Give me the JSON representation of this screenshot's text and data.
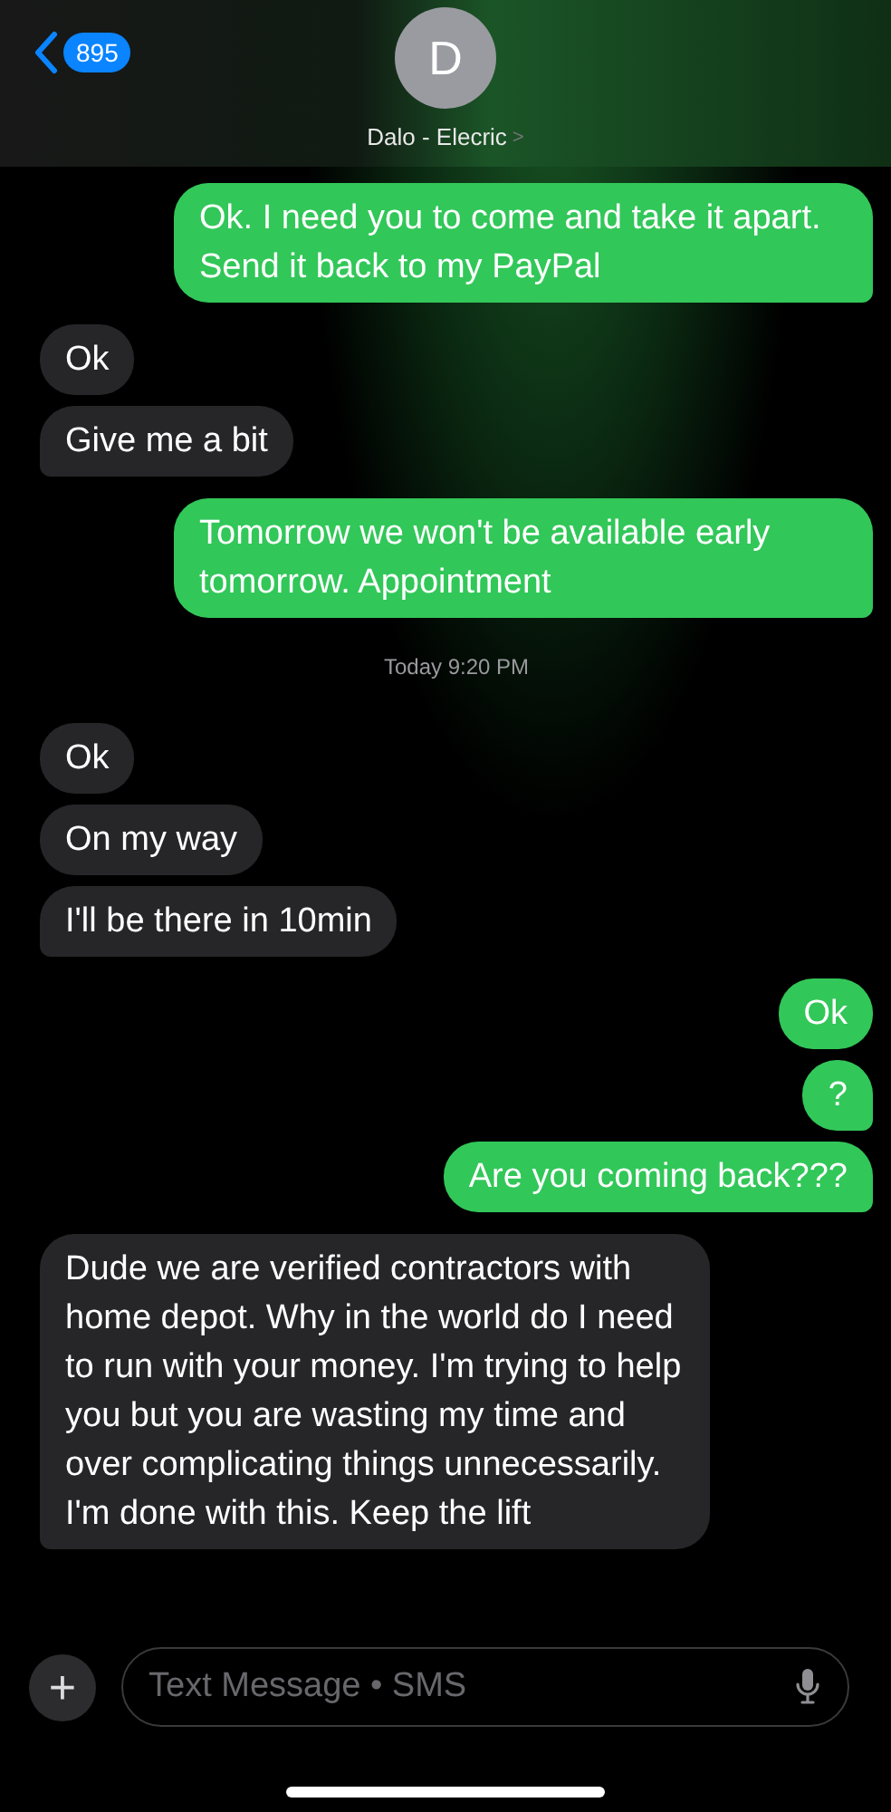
{
  "header": {
    "back_count": "895",
    "avatar_initial": "D",
    "contact_name": "Dalo - Elecric",
    "chevron": ">"
  },
  "messages": [
    {
      "kind": "sent",
      "text": "Ok. I need you to come and take it apart. Send it back to my PayPal",
      "tail": true
    },
    {
      "kind": "received",
      "text": "Ok",
      "tail": false
    },
    {
      "kind": "received",
      "text": "Give me a bit",
      "tail": true
    },
    {
      "kind": "sent",
      "text": "Tomorrow we won't be available early tomorrow. Appointment",
      "tail": true
    },
    {
      "kind": "timestamp",
      "text": "Today 9:20 PM"
    },
    {
      "kind": "received",
      "text": "Ok",
      "tail": false
    },
    {
      "kind": "received",
      "text": "On my way",
      "tail": false
    },
    {
      "kind": "received",
      "text": "I'll be there in 10min",
      "tail": true
    },
    {
      "kind": "sent",
      "text": "Ok",
      "tail": false
    },
    {
      "kind": "sent",
      "text": "?",
      "tail": true
    },
    {
      "kind": "sent",
      "text": "Are you coming back???",
      "tail": true
    },
    {
      "kind": "received",
      "text": "Dude we are verified contractors with home depot. Why in the world do I need to run with your money. I'm trying to help you but you are wasting my time and over complicating things unnecessarily. I'm done with this. Keep the lift",
      "tail": true
    }
  ],
  "composer": {
    "add": "+",
    "placeholder": "Text Message • SMS"
  }
}
